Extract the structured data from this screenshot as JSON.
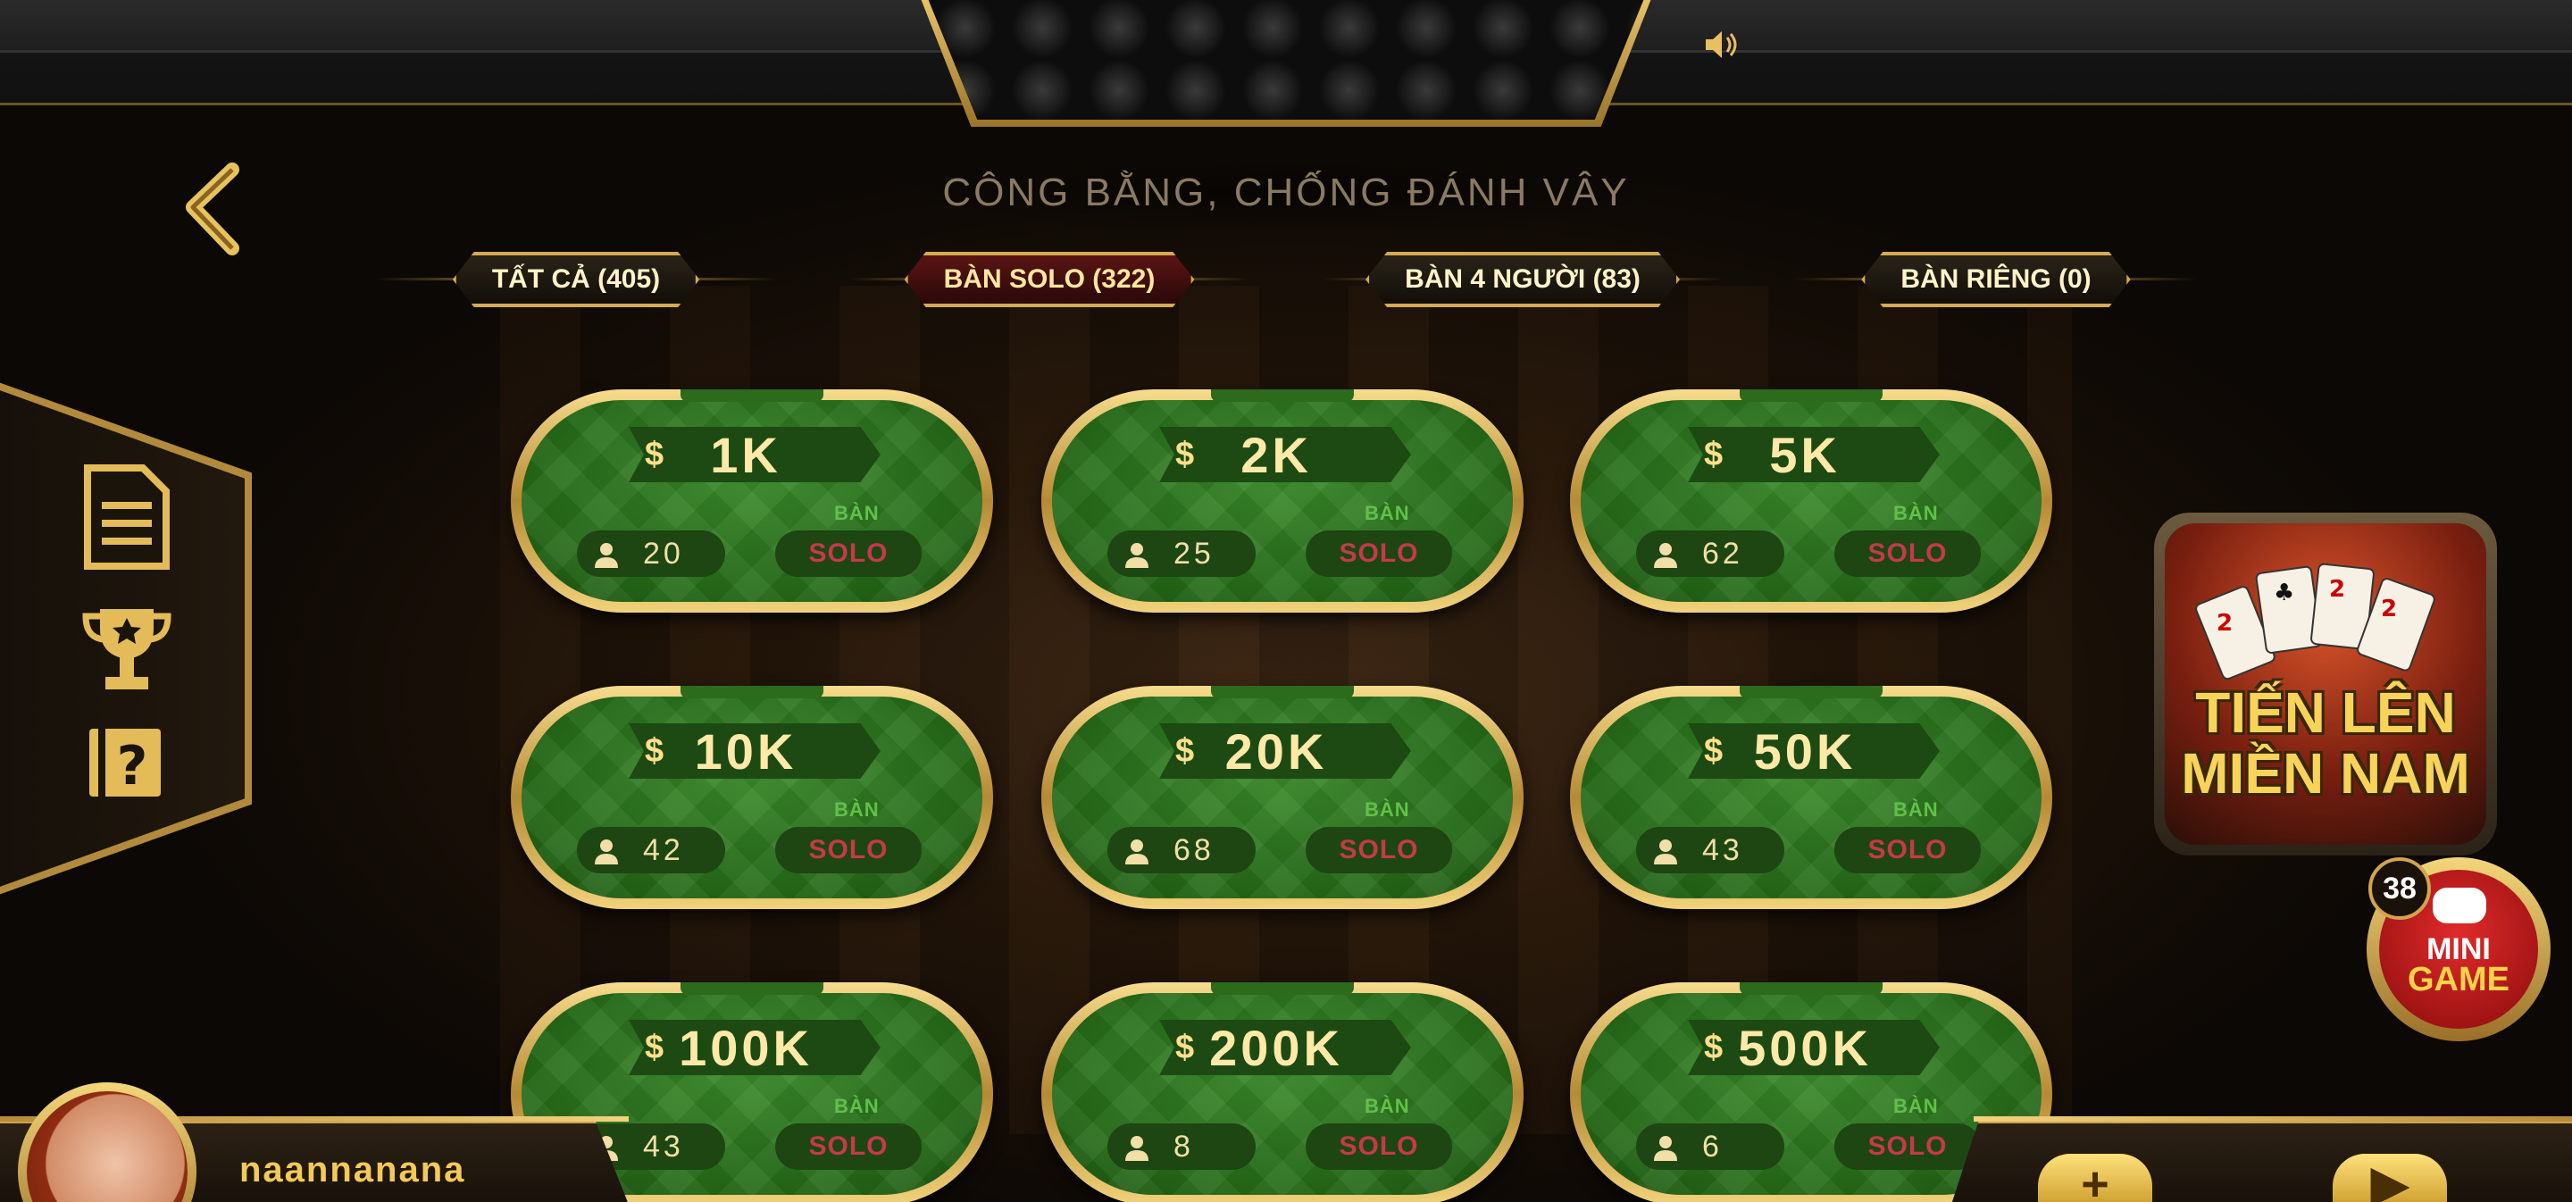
{
  "header": {
    "slogan": "CÔNG BẰNG, CHỐNG ĐÁNH VÂY",
    "sound_icon": "speaker-icon"
  },
  "tabs": [
    {
      "label": "TẤT CẢ (405)",
      "active": false
    },
    {
      "label": "BÀN SOLO (322)",
      "active": true
    },
    {
      "label": "BÀN 4 NGƯỜI (83)",
      "active": false
    },
    {
      "label": "BÀN RIÊNG (0)",
      "active": false
    }
  ],
  "side_menu": {
    "icons": [
      "document-icon",
      "trophy-icon",
      "help-book-icon"
    ]
  },
  "tables": [
    {
      "bet": "1K",
      "players": "20",
      "label_top": "BÀN",
      "label_bottom": "SOLO"
    },
    {
      "bet": "2K",
      "players": "25",
      "label_top": "BÀN",
      "label_bottom": "SOLO"
    },
    {
      "bet": "5K",
      "players": "62",
      "label_top": "BÀN",
      "label_bottom": "SOLO"
    },
    {
      "bet": "10K",
      "players": "42",
      "label_top": "BÀN",
      "label_bottom": "SOLO"
    },
    {
      "bet": "20K",
      "players": "68",
      "label_top": "BÀN",
      "label_bottom": "SOLO"
    },
    {
      "bet": "50K",
      "players": "43",
      "label_top": "BÀN",
      "label_bottom": "SOLO"
    },
    {
      "bet": "100K",
      "players": "43",
      "label_top": "BÀN",
      "label_bottom": "SOLO"
    },
    {
      "bet": "200K",
      "players": "8",
      "label_top": "BÀN",
      "label_bottom": "SOLO"
    },
    {
      "bet": "500K",
      "players": "6",
      "label_top": "BÀN",
      "label_bottom": "SOLO"
    }
  ],
  "currency_symbol": "$",
  "game_logo": {
    "title": "TIẾN LÊN\nMIỀN NAM"
  },
  "mini_game": {
    "badge": "38",
    "line1": "MINI",
    "line2": "GAME"
  },
  "user": {
    "name": "naannanana"
  },
  "bottom_buttons": [
    "add-icon",
    "play-icon"
  ],
  "colors": {
    "gold": "#d4ab52",
    "felt": "#2a7a1e",
    "solo_red": "#c5394a",
    "active_tab": "#5a1414"
  }
}
